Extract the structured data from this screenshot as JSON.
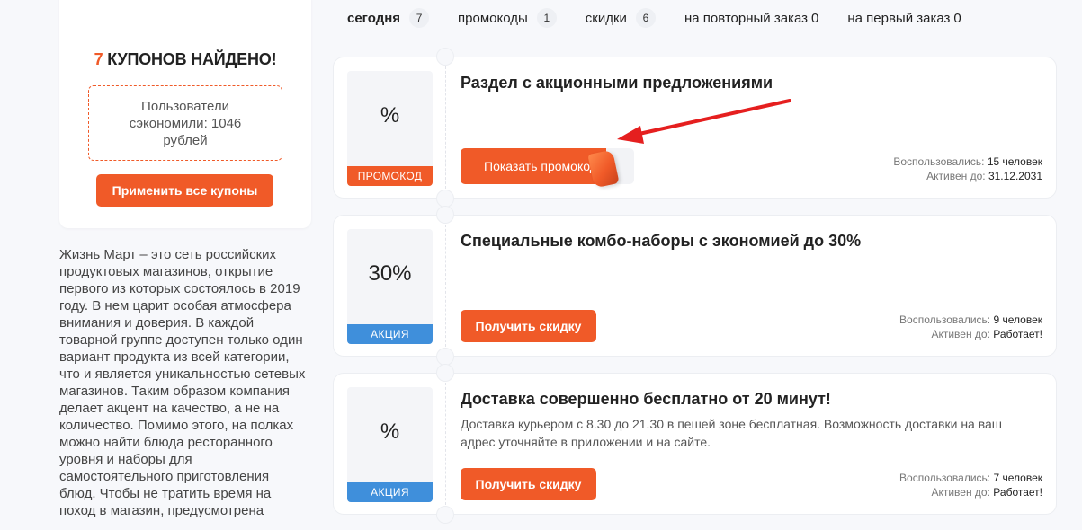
{
  "sidebar": {
    "found_count": "7",
    "found_text": "КУПОНОВ НАЙДЕНО!",
    "saved_text": "Пользователи сэкономили: 1046 рублей",
    "apply_all_label": "Применить все купоны",
    "about": "Жизнь Март – это сеть российских продуктовых магазинов, открытие первого из которых состоялось в 2019 году. В нем царит особая атмосфера внимания и доверия. В каждой товарной группе доступен только один вариант продукта из всей категории, что и является уникальностью сетевых магазинов. Таким образом компания делает акцент на качество, а не на количество. Помимо этого, на полках можно найти блюда ресторанного уровня и наборы для самостоятельного приготовления блюд. Чтобы не тратить время на поход в магазин, предусмотрена"
  },
  "tabs": [
    {
      "label": "сегодня",
      "count": "7"
    },
    {
      "label": "промокоды",
      "count": "1"
    },
    {
      "label": "скидки",
      "count": "6"
    },
    {
      "label": "на повторный заказ",
      "count": "0"
    },
    {
      "label": "на первый заказ",
      "count": "0"
    }
  ],
  "coupons": [
    {
      "badge_value": "%",
      "badge_tag": "ПРОМОКОД",
      "title": "Раздел с акционными предложениями",
      "description": "",
      "button_label": "Показать промокод",
      "used_label": "Воспользовались:",
      "used_value": "15 человек",
      "active_label": "Активен до:",
      "active_value": "31.12.2031"
    },
    {
      "badge_value": "30%",
      "badge_tag": "АКЦИЯ",
      "title": "Специальные комбо-наборы с экономией до 30%",
      "description": "",
      "button_label": "Получить скидку",
      "used_label": "Воспользовались:",
      "used_value": "9 человек",
      "active_label": "Активен до:",
      "active_value": "Работает!"
    },
    {
      "badge_value": "%",
      "badge_tag": "АКЦИЯ",
      "title": "Доставка совершенно бесплатно от 20 минут!",
      "description": "Доставка курьером с 8.30 до 21.30 в пешей зоне бесплатная. Возможность доставки на ваш адрес уточняйте в приложении и на сайте.",
      "button_label": "Получить скидку",
      "used_label": "Воспользовались:",
      "used_value": "7 человек",
      "active_label": "Активен до:",
      "active_value": "Работает!"
    }
  ],
  "colors": {
    "accent": "#f05a28",
    "sale_tag": "#3f8fdb",
    "arrow": "#e51f1f"
  }
}
